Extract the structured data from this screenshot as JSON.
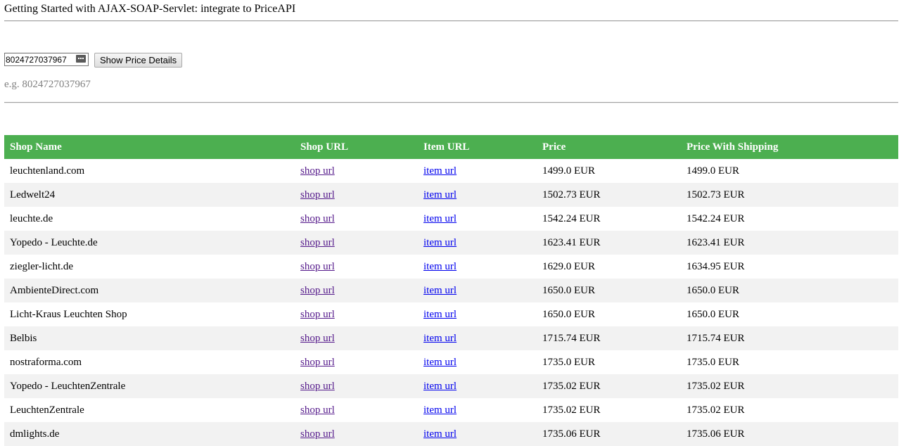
{
  "header": {
    "title": "Getting Started with AJAX-SOAP-Servlet: integrate to PriceAPI"
  },
  "search": {
    "value": "8024727037967",
    "button_label": "Show Price Details",
    "hint": "e.g. 8024727037967"
  },
  "table": {
    "columns": [
      "Shop Name",
      "Shop URL",
      "Item URL",
      "Price",
      "Price With Shipping"
    ],
    "link_labels": {
      "shop": "shop url",
      "item": "item url"
    },
    "rows": [
      {
        "shop": "leuchtenland.com",
        "price": "1499.0 EUR",
        "price_shipping": "1499.0 EUR"
      },
      {
        "shop": "Ledwelt24",
        "price": "1502.73 EUR",
        "price_shipping": "1502.73 EUR"
      },
      {
        "shop": "leuchte.de",
        "price": "1542.24 EUR",
        "price_shipping": "1542.24 EUR"
      },
      {
        "shop": "Yopedo - Leuchte.de",
        "price": "1623.41 EUR",
        "price_shipping": "1623.41 EUR"
      },
      {
        "shop": "ziegler-licht.de",
        "price": "1629.0 EUR",
        "price_shipping": "1634.95 EUR"
      },
      {
        "shop": "AmbienteDirect.com",
        "price": "1650.0 EUR",
        "price_shipping": "1650.0 EUR"
      },
      {
        "shop": "Licht-Kraus Leuchten Shop",
        "price": "1650.0 EUR",
        "price_shipping": "1650.0 EUR"
      },
      {
        "shop": "Belbis",
        "price": "1715.74 EUR",
        "price_shipping": "1715.74 EUR"
      },
      {
        "shop": "nostraforma.com",
        "price": "1735.0 EUR",
        "price_shipping": "1735.0 EUR"
      },
      {
        "shop": "Yopedo - LeuchtenZentrale",
        "price": "1735.02 EUR",
        "price_shipping": "1735.02 EUR"
      },
      {
        "shop": "LeuchtenZentrale",
        "price": "1735.02 EUR",
        "price_shipping": "1735.02 EUR"
      },
      {
        "shop": "dmlights.de",
        "price": "1735.06 EUR",
        "price_shipping": "1735.06 EUR"
      }
    ]
  },
  "colors": {
    "header_bg": "#4caf50",
    "stripe": "#f2f2f2",
    "visited_link": "#551a8b",
    "link": "#0000ee"
  },
  "icons": {
    "input_picker": "ellipsis-icon"
  }
}
